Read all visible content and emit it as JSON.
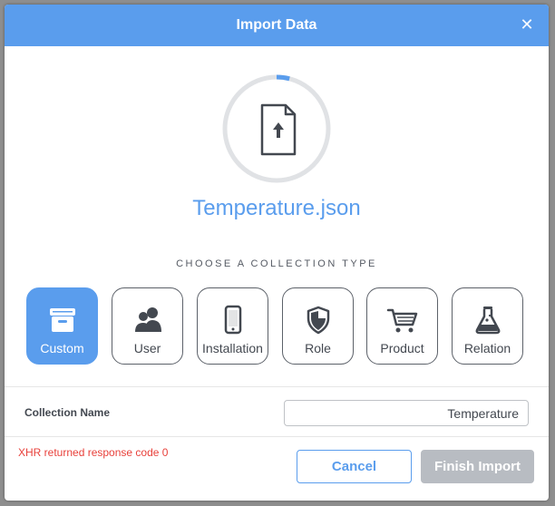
{
  "dialog": {
    "title": "Import Data",
    "close_glyph": "✕"
  },
  "upload": {
    "file_name": "Temperature.json",
    "progress": 0.04,
    "icon": "file-upload-icon",
    "accent_color": "#5a9ded",
    "track_color": "#e0e2e5"
  },
  "collection_type": {
    "section_label": "CHOOSE A COLLECTION TYPE",
    "selected": "Custom",
    "options": [
      {
        "label": "Custom",
        "icon": "archive-box-icon"
      },
      {
        "label": "User",
        "icon": "users-icon"
      },
      {
        "label": "Installation",
        "icon": "mobile-phone-icon"
      },
      {
        "label": "Role",
        "icon": "shield-icon"
      },
      {
        "label": "Product",
        "icon": "shopping-cart-icon"
      },
      {
        "label": "Relation",
        "icon": "flask-icon"
      }
    ]
  },
  "collection_name": {
    "label": "Collection Name",
    "value": "Temperature"
  },
  "footer": {
    "error_message": "XHR returned response code 0",
    "cancel_label": "Cancel",
    "finish_label": "Finish Import",
    "error_color": "#e8413b",
    "disabled_color": "#b8bcc2"
  }
}
